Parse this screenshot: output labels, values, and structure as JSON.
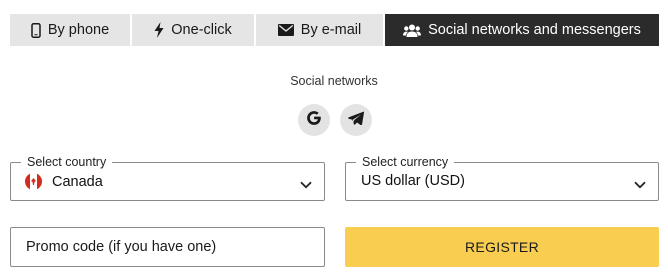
{
  "tabs": [
    {
      "label": "By phone",
      "icon": "phone-icon",
      "active": false
    },
    {
      "label": "One-click",
      "icon": "lightning-icon",
      "active": false
    },
    {
      "label": "By e-mail",
      "icon": "envelope-icon",
      "active": false
    },
    {
      "label": "Social networks and messengers",
      "icon": "users-icon",
      "active": true
    }
  ],
  "social": {
    "label": "Social networks",
    "buttons": [
      {
        "icon": "google-icon"
      },
      {
        "icon": "telegram-icon"
      }
    ]
  },
  "country": {
    "label": "Select country",
    "value": "Canada",
    "icon": "canada-flag-icon"
  },
  "currency": {
    "label": "Select currency",
    "value": "US dollar (USD)"
  },
  "promo": {
    "placeholder": "Promo code (if you have one)"
  },
  "register": {
    "label": "REGISTER"
  },
  "colors": {
    "tab_bg": "#e5e5e5",
    "tab_active_bg": "#2b2b2b",
    "register_bg": "#f8cd50",
    "social_btn_bg": "#e3e3e3"
  }
}
